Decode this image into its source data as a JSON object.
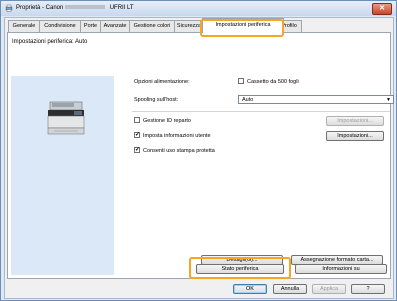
{
  "window": {
    "title_prefix": "Proprietà - Canon",
    "title_suffix": "UFRII LT",
    "close_glyph": "✕"
  },
  "tabs": [
    {
      "label": "Generale"
    },
    {
      "label": "Condivisione"
    },
    {
      "label": "Porte"
    },
    {
      "label": "Avanzate"
    },
    {
      "label": "Gestione colori"
    },
    {
      "label": "Sicurezza"
    },
    {
      "label": "Impostazioni periferica"
    },
    {
      "label": "Profilo"
    }
  ],
  "device": {
    "header": "Impostazioni periferica: Auto",
    "power_options_label": "Opzioni alimentazione:",
    "paper_cassette_label": "Cassetto da 500 fogli",
    "paper_cassette_checked": false,
    "spooling_label": "Spooling sull'host:",
    "spooling_value": "Auto",
    "dept_id_label": "Gestione ID reparto",
    "dept_id_checked": false,
    "user_info_label": "Imposta informazioni utente",
    "user_info_checked": true,
    "secure_print_label": "Consenti uso stampa protetta",
    "secure_print_checked": true,
    "settings_label": "Impostazioni...",
    "check_glyph": "✓",
    "dropdown_glyph": "▼"
  },
  "buttons": {
    "details": "Dettagli(G)...",
    "paper_format": "Assegnazione formato carta...",
    "device_status": "Stato periferica",
    "about": "Informazioni su",
    "ok": "OK",
    "cancel": "Annulla",
    "apply": "Applica",
    "help": "?"
  }
}
